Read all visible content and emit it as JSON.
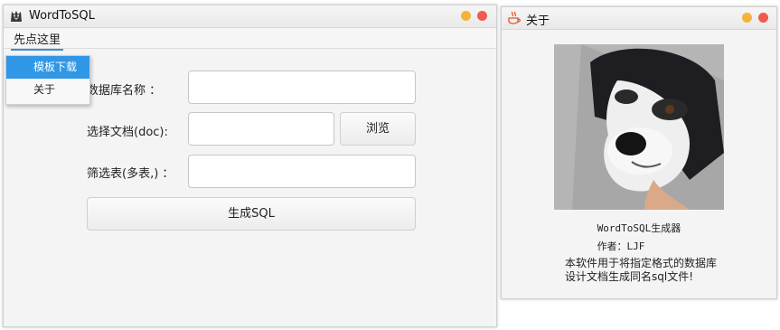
{
  "main_window": {
    "title": "WordToSQL",
    "menu": {
      "title": "先点这里",
      "items": [
        {
          "label": "模板下载",
          "active": true
        },
        {
          "label": "关于",
          "active": false
        }
      ]
    },
    "form": {
      "db_name_label": "数据库名称 ：",
      "db_name_value": "",
      "doc_label": "选择文档(doc):",
      "doc_value": "",
      "browse_label": "浏览",
      "filter_label": "筛选表(多表,) ：",
      "filter_value": "",
      "generate_label": "生成SQL"
    }
  },
  "about_window": {
    "title": "关于",
    "app_name": "WordToSQL生成器",
    "author": "作者：LJF",
    "description_line1": "本软件用于将指定格式的数据库",
    "description_line2": "设计文档生成同名sql文件!"
  },
  "colors": {
    "accent": "#2f97e6",
    "close_dot": "#f05a4f",
    "minimize_dot": "#f4b43a"
  }
}
